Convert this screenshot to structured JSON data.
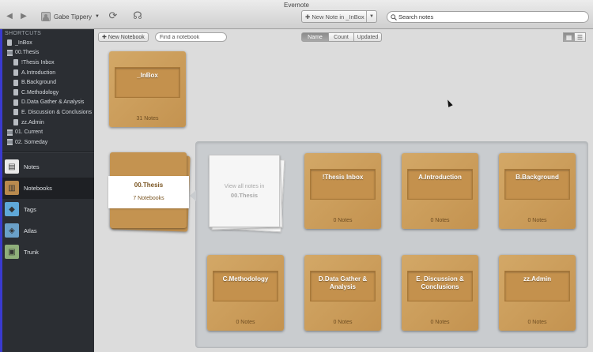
{
  "window": {
    "title": "Evernote"
  },
  "toolbar": {
    "user_name": "Gabe Tippery",
    "new_note_label": "New Note in _InBox",
    "search_placeholder": "Search notes"
  },
  "sidebar": {
    "shortcuts_header": "SHORTCUTS",
    "shortcuts": [
      {
        "label": "_InBox",
        "kind": "notebook",
        "indent": 0
      },
      {
        "label": "00.Thesis",
        "kind": "stack",
        "indent": 0
      },
      {
        "label": "!Thesis Inbox",
        "kind": "notebook",
        "indent": 1
      },
      {
        "label": "A.Introduction",
        "kind": "notebook",
        "indent": 1
      },
      {
        "label": "B.Background",
        "kind": "notebook",
        "indent": 1
      },
      {
        "label": "C.Methodology",
        "kind": "notebook",
        "indent": 1
      },
      {
        "label": "D.Data Gather & Analysis",
        "kind": "notebook",
        "indent": 1
      },
      {
        "label": "E. Discussion & Conclusions",
        "kind": "notebook",
        "indent": 1
      },
      {
        "label": "zz.Admin",
        "kind": "notebook",
        "indent": 1
      },
      {
        "label": "01. Current",
        "kind": "stack",
        "indent": 0
      },
      {
        "label": "02. Someday",
        "kind": "stack",
        "indent": 0
      }
    ],
    "nav": [
      {
        "label": "Notes",
        "icon": "notes-icon",
        "color": "#e9e9e9",
        "active": false
      },
      {
        "label": "Notebooks",
        "icon": "notebooks-icon",
        "color": "#b98a4e",
        "active": true
      },
      {
        "label": "Tags",
        "icon": "tags-icon",
        "color": "#5fa8d8",
        "active": false
      },
      {
        "label": "Atlas",
        "icon": "atlas-icon",
        "color": "#6aa0c8",
        "active": false
      },
      {
        "label": "Trunk",
        "icon": "trunk-icon",
        "color": "#8fae7a",
        "active": false
      }
    ]
  },
  "content_toolbar": {
    "new_notebook_label": "New Notebook",
    "find_placeholder": "Find a notebook",
    "sort": {
      "options": [
        "Name",
        "Count",
        "Updated"
      ],
      "selected": "Name"
    }
  },
  "notebooks": {
    "inbox": {
      "name": "_InBox",
      "count": "31 Notes"
    },
    "thesis_stack": {
      "name": "00.Thesis",
      "count": "7 Notebooks"
    },
    "view_all": {
      "line1": "View all notes in",
      "line2": "00.Thesis"
    },
    "stack_items": [
      {
        "name": "!Thesis Inbox",
        "count": "0 Notes"
      },
      {
        "name": "A.Introduction",
        "count": "0 Notes"
      },
      {
        "name": "B.Background",
        "count": "0 Notes"
      },
      {
        "name": "C.Methodology",
        "count": "0 Notes"
      },
      {
        "name": "D.Data Gather & Analysis",
        "count": "0 Notes"
      },
      {
        "name": "E. Discussion & Conclusions",
        "count": "0 Notes"
      },
      {
        "name": "zz.Admin",
        "count": "0 Notes"
      }
    ]
  },
  "colors": {
    "sidebar_bg": "#2b2e33",
    "notebook_tan": "#c49350",
    "accent_edge": "#3a3ad0"
  }
}
